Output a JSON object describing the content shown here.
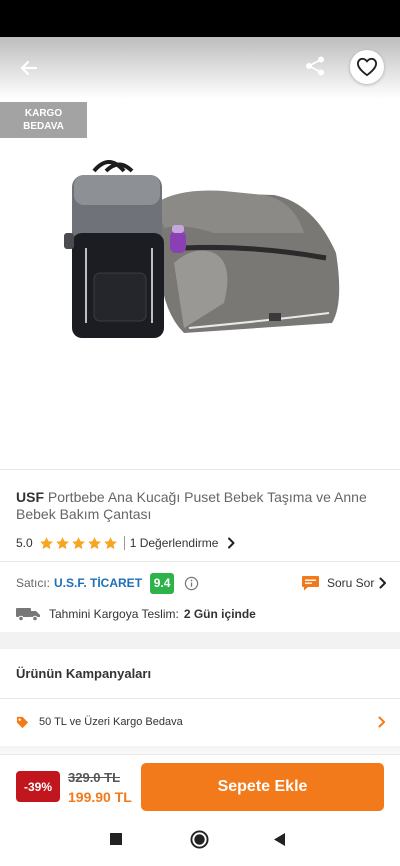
{
  "header": {
    "back_icon": "arrow-left-icon",
    "share_icon": "share-icon",
    "favorite_icon": "heart-outline-icon"
  },
  "badge": {
    "line1": "KARGO",
    "line2": "BEDAVA"
  },
  "product": {
    "brand": "USF",
    "title": "Portbebe Ana Kucağı Puset Bebek Taşıma ve Anne Bebek Bakım Çantası",
    "rating": "5.0",
    "stars": 5,
    "review_count": "1 Değerlendirme"
  },
  "seller": {
    "label": "Satıcı:",
    "name": "U.S.F. TİCARET",
    "score": "9.4"
  },
  "question": {
    "label": "Soru Sor"
  },
  "delivery": {
    "label": "Tahmini Kargoya Teslim:",
    "days": "2 Gün içinde"
  },
  "campaigns": {
    "title": "Ürünün Kampanyaları",
    "items": [
      {
        "text": "50 TL ve Üzeri Kargo Bedava"
      }
    ]
  },
  "price": {
    "discount": "-39%",
    "old": "329.0 TL",
    "new": "199.90 TL"
  },
  "cart": {
    "button_label": "Sepete Ekle"
  },
  "colors": {
    "accent": "#f27a1a",
    "seller_link": "#1e6fb7",
    "seller_score_bg": "#2db34a",
    "discount_bg": "#c1161d",
    "star": "#f5a623"
  }
}
